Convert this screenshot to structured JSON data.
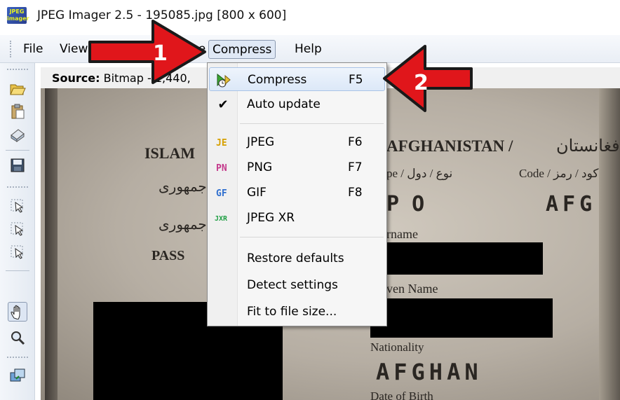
{
  "window": {
    "title": "JPEG Imager 2.5 - 195085.jpg [800 x 600]",
    "app_icon_text": "JPEG imager"
  },
  "menubar": {
    "items": [
      {
        "label": "File"
      },
      {
        "label": "View"
      },
      {
        "label": "Image"
      },
      {
        "label": "Compress"
      },
      {
        "label": "Help"
      }
    ]
  },
  "source": {
    "label": "Source:",
    "value": "Bitmap - 1,440,"
  },
  "dropdown": {
    "items": [
      {
        "label": "Compress",
        "shortcut": "F5",
        "icon": "compress-icon"
      },
      {
        "label": "Auto update",
        "shortcut": "",
        "icon": "check-icon"
      },
      {
        "label": "JPEG",
        "shortcut": "F6",
        "icon": "jpeg-icon"
      },
      {
        "label": "PNG",
        "shortcut": "F7",
        "icon": "png-icon"
      },
      {
        "label": "GIF",
        "shortcut": "F8",
        "icon": "gif-icon"
      },
      {
        "label": "JPEG XR",
        "shortcut": "",
        "icon": "jpegxr-icon"
      },
      {
        "label": "Restore defaults",
        "shortcut": ""
      },
      {
        "label": "Detect settings",
        "shortcut": ""
      },
      {
        "label": "Fit to file size...",
        "shortcut": ""
      }
    ]
  },
  "annotations": {
    "arrow1_number": "1",
    "arrow2_number": "2",
    "arrow_color": "#e0161b"
  },
  "passport": {
    "islam": "ISLAM",
    "country": "AFGHANISTAN /",
    "country_ar": "افغانستان",
    "type": "pe / نوع / دول",
    "code": "Code / کود / رمز",
    "code_value": "AFG",
    "p_value": "P O",
    "surname": "rname",
    "given_name": "ven Name",
    "nationality": "Nationality",
    "nationality_value": "AFGHAN",
    "passport_label": "PASS",
    "ar1": "جمهوری",
    "ar2": "جمهوری",
    "dob": "Date of Birth"
  }
}
